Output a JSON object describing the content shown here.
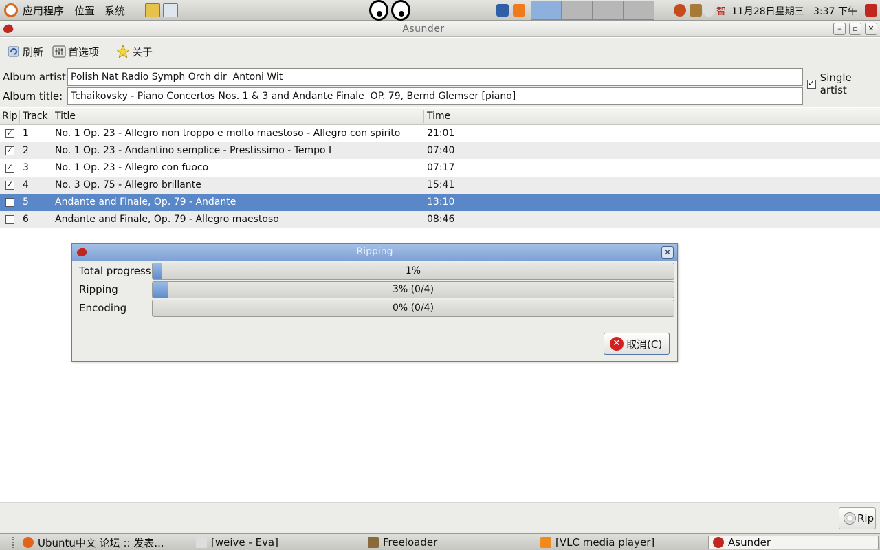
{
  "top_panel": {
    "menus": [
      "应用程序",
      "位置",
      "系统"
    ],
    "datetime": "11月28日星期三",
    "time": "3:37 下午",
    "tray_text": "智"
  },
  "window": {
    "title": "Asunder",
    "minimize": "–",
    "maximize": "▫",
    "close": "✕"
  },
  "toolbar": {
    "refresh": "刷新",
    "preferences": "首选项",
    "about": "关于"
  },
  "album": {
    "artist_label": "Album artist:",
    "artist_value": "Polish Nat Radio Symph Orch dir  Antoni Wit",
    "title_label": "Album title:",
    "title_value": "Tchaikovsky - Piano Concertos Nos. 1 & 3 and Andante Finale  OP. 79, Bernd Glemser [piano]",
    "single_artist_label": "Single artist",
    "single_artist_checked": true
  },
  "tracklist": {
    "headers": {
      "rip": "Rip",
      "track": "Track",
      "title": "Title",
      "time": "Time"
    },
    "tracks": [
      {
        "rip": true,
        "track": "1",
        "title": "No. 1 Op. 23 - Allegro non troppo e molto maestoso - Allegro con spirito",
        "time": "21:01"
      },
      {
        "rip": true,
        "track": "2",
        "title": "No. 1 Op. 23 - Andantino semplice  - Prestissimo - Tempo I",
        "time": "07:40"
      },
      {
        "rip": true,
        "track": "3",
        "title": "No. 1 Op. 23 - Allegro con fuoco",
        "time": "07:17"
      },
      {
        "rip": true,
        "track": "4",
        "title": "No. 3 Op. 75 - Allegro brillante",
        "time": "15:41"
      },
      {
        "rip": false,
        "track": "5",
        "title": "Andante and Finale, Op. 79 - Andante",
        "time": "13:10",
        "selected": true
      },
      {
        "rip": false,
        "track": "6",
        "title": "Andante and Finale, Op. 79 - Allegro maestoso",
        "time": "08:46"
      }
    ]
  },
  "ripping_dialog": {
    "title": "Ripping",
    "close": "✕",
    "total_label": "Total progress",
    "total_text": "1%",
    "total_fraction": 0.01,
    "ripping_label": "Ripping",
    "ripping_text": "3% (0/4)",
    "ripping_fraction": 0.03,
    "encoding_label": "Encoding",
    "encoding_text": "0% (0/4)",
    "encoding_fraction": 0.0,
    "cancel_label": "取消(C)"
  },
  "bottom": {
    "rip_label": "Rip"
  },
  "taskbar": {
    "items": [
      {
        "label": "Ubuntu中文 论坛 :: 发表...",
        "icon": "firefox-icon"
      },
      {
        "label": "[weive - Eva]",
        "icon": "document-icon"
      },
      {
        "label": "Freeloader",
        "icon": "freeloader-icon"
      },
      {
        "label": "[VLC media player]",
        "icon": "vlc-icon"
      },
      {
        "label": "Asunder",
        "icon": "asunder-icon",
        "active": true
      }
    ]
  },
  "colors": {
    "selection": "#5a87c8",
    "progress_fill": "#5e8ccc",
    "dialog_title": "#7ea1d4",
    "cancel_icon": "#d32020"
  }
}
